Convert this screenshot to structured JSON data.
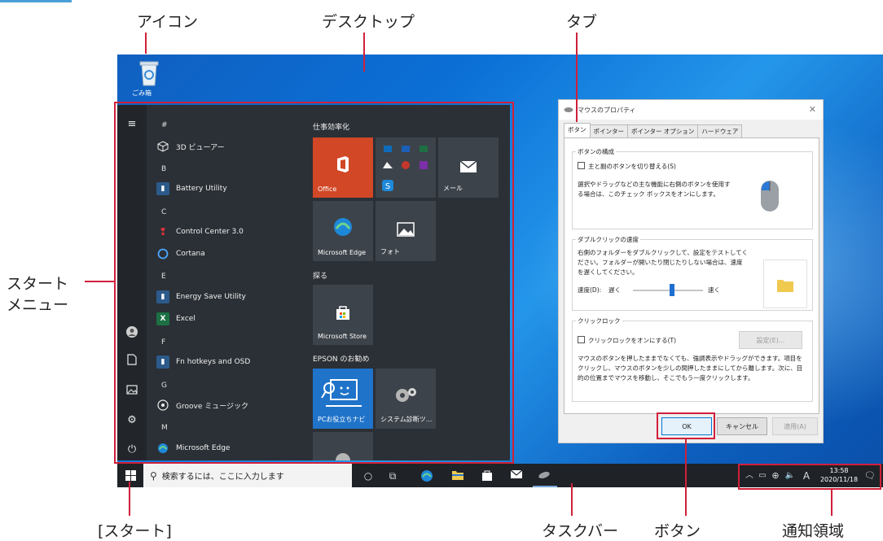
{
  "callouts": {
    "icon": "アイコン",
    "desktop": "デスクトップ",
    "tab": "タブ",
    "start_menu_line1": "スタート",
    "start_menu_line2": "メニュー",
    "start_button": "[スタート]",
    "taskbar": "タスクバー",
    "button": "ボタン",
    "notification_area": "通知領域"
  },
  "desktop": {
    "recycle_bin_label": "ごみ箱"
  },
  "start_menu": {
    "letters": [
      "#",
      "B",
      "C",
      "E",
      "F",
      "G",
      "M"
    ],
    "apps": [
      {
        "label": "3D ビューアー",
        "icon": "cube-icon"
      },
      {
        "label": "Battery Utility",
        "icon": "battery-icon"
      },
      {
        "label": "Control Center 3.0",
        "icon": "control-center-icon"
      },
      {
        "label": "Cortana",
        "icon": "cortana-icon"
      },
      {
        "label": "Energy Save Utility",
        "icon": "energy-icon"
      },
      {
        "label": "Excel",
        "icon": "excel-icon"
      },
      {
        "label": "Fn hotkeys and OSD",
        "icon": "fn-icon"
      },
      {
        "label": "Groove ミュージック",
        "icon": "groove-icon"
      },
      {
        "label": "Microsoft Edge",
        "icon": "edge-icon"
      }
    ],
    "sections": [
      "仕事効率化",
      "探る",
      "EPSON のお勧め"
    ],
    "tiles": {
      "office": "Office",
      "mail": "メール",
      "edge": "Microsoft Edge",
      "photos": "フォト",
      "store": "Microsoft Store",
      "pc_help": "PCお役立ちナビ",
      "diagnostics": "システム診断ツ..."
    }
  },
  "dialog": {
    "title": "マウスのプロパティ",
    "tabs": [
      "ボタン",
      "ポインター",
      "ポインター オプション",
      "ハードウェア"
    ],
    "group1_title": "ボタンの構成",
    "group1_check": "主と副のボタンを切り替える(S)",
    "group1_text1": "選択やドラッグなどの主な機能に右側のボタンを使用す",
    "group1_text2": "る場合は、このチェック ボックスをオンにします。",
    "group2_title": "ダブルクリックの速度",
    "group2_text1": "右側のフォルダーをダブルクリックして、設定をテストしてく",
    "group2_text2": "ださい。フォルダーが開いたり閉じたりしない場合は、速度",
    "group2_text3": "を遅くしてください。",
    "speed_label": "速度(D):",
    "slow": "遅く",
    "fast": "速く",
    "group3_title": "クリックロック",
    "group3_check": "クリックロックをオンにする(T)",
    "settings_btn": "設定(E)...",
    "group3_text1": "マウスのボタンを押したままでなくても、強調表示やドラッグができます。項目を",
    "group3_text2": "クリックし、マウスのボタンを少しの間押したままにしてから離します。次に、目",
    "group3_text3": "的の位置までマウスを移動し、そこでもう一度クリックします。",
    "ok": "OK",
    "cancel": "キャンセル",
    "apply": "適用(A)"
  },
  "taskbar": {
    "search_placeholder": "検索するには、ここに入力します",
    "ime": "A",
    "time": "13:58",
    "date": "2020/11/18"
  },
  "colors": {
    "highlight": "#d0203a",
    "office_tile": "#d24726",
    "pc_help_tile": "#1f73c9",
    "start_bg": "#2b3036"
  }
}
